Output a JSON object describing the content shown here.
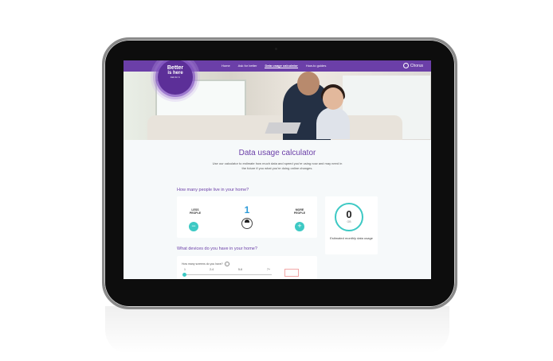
{
  "nav": {
    "items": [
      "Home",
      "Ask for better",
      "Data usage calculator",
      "How-to guides"
    ],
    "active_index": 2,
    "brand": "Chorus"
  },
  "badge": {
    "line1": "Better",
    "line2": "is here",
    "line3": "Ask for it."
  },
  "page": {
    "title": "Data usage calculator",
    "intro": "Use our calculator to estimate how much data and speed you're using now and may need in the future if you what you're doing online changes."
  },
  "people": {
    "question": "How many people live in your home?",
    "less_label": "LESS PEOPLE",
    "more_label": "MORE PEOPLE",
    "count": "1",
    "minus_icon": "−",
    "plus_icon": "+"
  },
  "usage": {
    "value": "0",
    "unit": "GB",
    "label": "Estimated monthly data usage"
  },
  "devices": {
    "question": "What devices do you have in your home?",
    "sub_question": "How many screens do you have?",
    "info_icon": "i",
    "options": [
      "1",
      "2-4",
      "5-6",
      "7+"
    ],
    "selected": "1"
  },
  "colors": {
    "brand_purple": "#6b3fa8",
    "accent_teal": "#3dc9c4",
    "count_blue": "#2c9ad8"
  }
}
